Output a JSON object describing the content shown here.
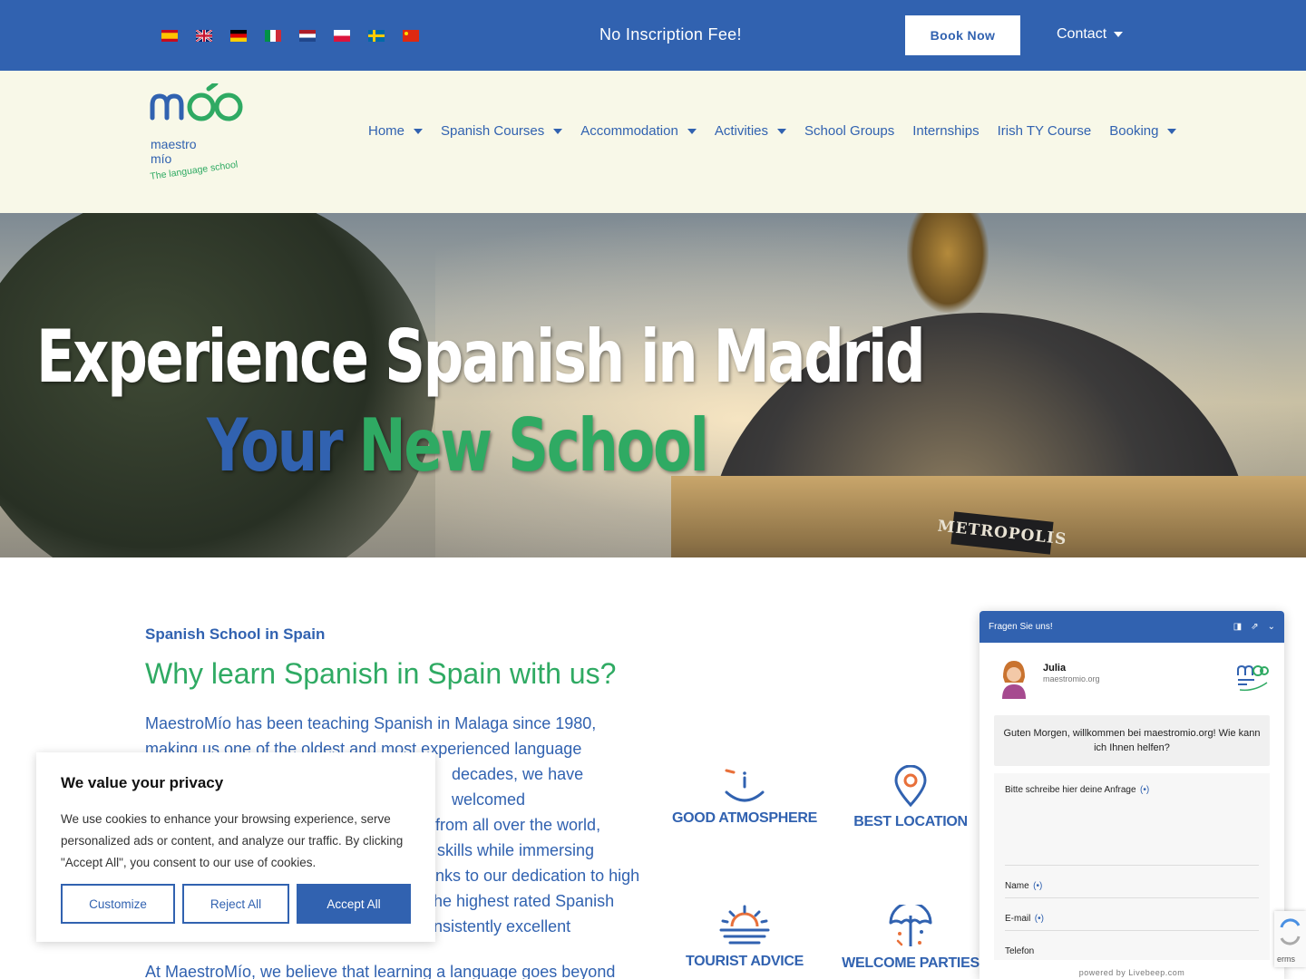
{
  "topbar": {
    "flags": [
      {
        "name": "spanish-flag-icon",
        "colors": [
          "#c60b1e",
          "#ffc400",
          "#c60b1e"
        ]
      },
      {
        "name": "uk-flag-icon",
        "colors": [
          "#012169",
          "#ffffff",
          "#c8102e"
        ]
      },
      {
        "name": "german-flag-icon",
        "colors": [
          "#000000",
          "#dd0000",
          "#ffce00"
        ]
      },
      {
        "name": "italian-flag-icon",
        "colors": [
          "#009246",
          "#ffffff",
          "#ce2b37"
        ]
      },
      {
        "name": "dutch-flag-icon",
        "colors": [
          "#ae1c28",
          "#ffffff",
          "#21468b"
        ]
      },
      {
        "name": "polish-flag-icon",
        "colors": [
          "#ffffff",
          "#dc143c"
        ]
      },
      {
        "name": "swedish-flag-icon",
        "colors": [
          "#006aa7",
          "#fecc00"
        ]
      },
      {
        "name": "chinese-flag-icon",
        "colors": [
          "#de2910",
          "#ffde00"
        ]
      }
    ],
    "promo": "No Inscription Fee!",
    "book_label": "Book Now",
    "contact_label": "Contact"
  },
  "header": {
    "logo_text": {
      "brand": "maestro",
      "brand2": "mío",
      "tagline": "The language school"
    },
    "nav": [
      {
        "label": "Home",
        "dropdown": true
      },
      {
        "label": "Spanish Courses",
        "dropdown": true
      },
      {
        "label": "Accommodation",
        "dropdown": true
      },
      {
        "label": "Activities",
        "dropdown": true
      },
      {
        "label": "School Groups",
        "dropdown": false
      },
      {
        "label": "Internships",
        "dropdown": false
      },
      {
        "label": "Irish TY Course",
        "dropdown": false
      },
      {
        "label": "Booking",
        "dropdown": true
      }
    ]
  },
  "hero": {
    "title": "Experience Spanish in Madrid",
    "sub_word1": "Your",
    "sub_word2": "New School",
    "sign": "METROPOLIS"
  },
  "content": {
    "eyebrow": "Spanish School in Spain",
    "heading": "Why learn Spanish in Spain with us?",
    "paragraph": "MaestroMío has been teaching Spanish in Malaga since 1980, making us one of the oldest and most experienced language decades, we have welcomed from all over the world, skills while immersing nks to our dedication to high he highest rated Spanish onsistently excellent",
    "paragraph_lines": [
      "MaestroMío has been teaching Spanish in Malaga since 1980,",
      "making us one of the oldest and most experienced language",
      "decades, we have welcomed",
      "from all over the world,",
      "skills while immersing",
      "nks to our dedication to high",
      "he highest rated Spanish",
      "onsistently excellent"
    ],
    "paragraph2": "At MaestroMío, we believe that learning a language goes beyond",
    "features": [
      {
        "label": "GOOD ATMOSPHERE",
        "icon": "smile-icon"
      },
      {
        "label": "BEST LOCATION",
        "icon": "location-pin-icon"
      },
      {
        "label": "TOURIST ADVICE",
        "icon": "sunset-icon"
      },
      {
        "label": "WELCOME PARTIES",
        "icon": "party-balloons-icon"
      }
    ],
    "colors": {
      "blue": "#3162b0",
      "green": "#2faa63",
      "orange": "#e8703a"
    }
  },
  "cookie": {
    "title": "We value your privacy",
    "text": "We use cookies to enhance your browsing experience, serve personalized ads or content, and analyze our traffic. By clicking \"Accept All\", you consent to our use of cookies.",
    "customize": "Customize",
    "reject": "Reject All",
    "accept": "Accept All"
  },
  "chat": {
    "header": "Fragen Sie uns!",
    "agent_name": "Julia",
    "agent_site": "maestromio.org",
    "greeting": "Guten Morgen, willkommen bei maestromio.org! Wie kann ich Ihnen helfen?",
    "request_label": "Bitte schreibe hier deine Anfrage",
    "name_label": "Name",
    "email_label": "E-mail",
    "phone_label": "Telefon",
    "required_mark": "(•)",
    "powered": "powered by Livebeep.com"
  },
  "recaptcha": {
    "text": "erms"
  }
}
